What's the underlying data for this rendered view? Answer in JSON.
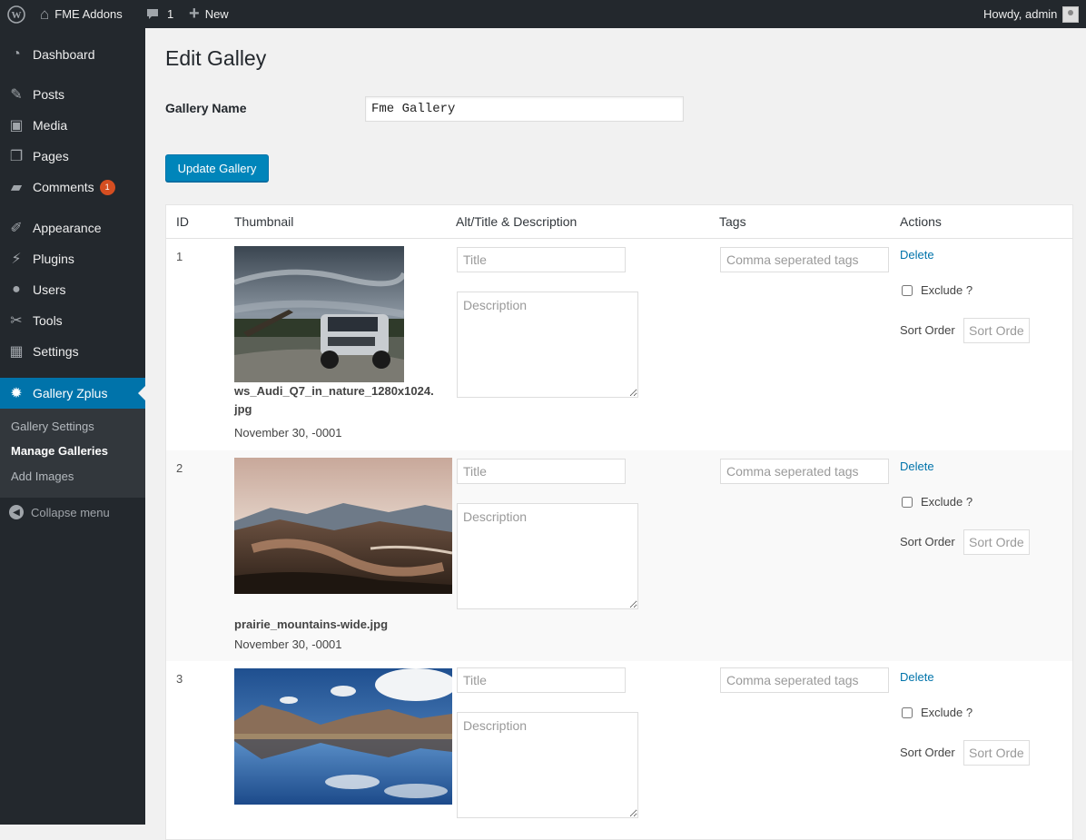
{
  "adminbar": {
    "site_name": "FME Addons",
    "comments_count": "1",
    "new_label": "New",
    "howdy": "Howdy, admin"
  },
  "sidebar": {
    "items": [
      {
        "label": "Dashboard",
        "icon": "dashboard-icon"
      },
      {
        "label": "Posts",
        "icon": "pin-icon"
      },
      {
        "label": "Media",
        "icon": "media-icon"
      },
      {
        "label": "Pages",
        "icon": "pages-icon"
      },
      {
        "label": "Comments",
        "icon": "comment-icon",
        "badge": "1"
      },
      {
        "label": "Appearance",
        "icon": "brush-icon"
      },
      {
        "label": "Plugins",
        "icon": "plug-icon"
      },
      {
        "label": "Users",
        "icon": "user-icon"
      },
      {
        "label": "Tools",
        "icon": "wrench-icon"
      },
      {
        "label": "Settings",
        "icon": "settings-icon"
      },
      {
        "label": "Gallery Zplus",
        "icon": "gear-icon"
      }
    ],
    "submenu": [
      "Gallery Settings",
      "Manage Galleries",
      "Add Images"
    ],
    "collapse": "Collapse menu"
  },
  "page": {
    "title": "Edit Galley",
    "gallery_name_label": "Gallery Name",
    "gallery_name_value": "Fme Gallery",
    "update_button": "Update Gallery"
  },
  "table": {
    "headers": [
      "ID",
      "Thumbnail",
      "Alt/Title & Description",
      "Tags",
      "Actions"
    ],
    "title_placeholder": "Title",
    "desc_placeholder": "Description",
    "tags_placeholder": "Comma seperated tags",
    "delete_label": "Delete",
    "exclude_label": "Exclude ?",
    "sort_label": "Sort Order",
    "sort_placeholder": "Sort Order",
    "rows": [
      {
        "id": "1",
        "filename": "ws_Audi_Q7_in_nature_1280x1024.jpg",
        "date": "November 30, -0001"
      },
      {
        "id": "2",
        "filename": "prairie_mountains-wide.jpg",
        "date": "November 30, -0001"
      },
      {
        "id": "3"
      }
    ]
  },
  "colors": {
    "accent": "#0073aa",
    "button": "#0085ba",
    "sidebar_bg": "#23282d",
    "badge": "#d54e21"
  }
}
